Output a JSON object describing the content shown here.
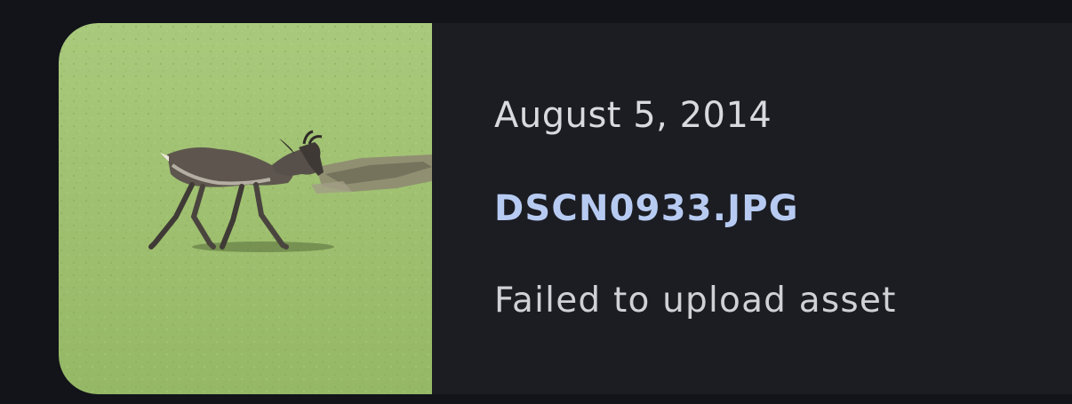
{
  "asset": {
    "date": "August 5, 2014",
    "filename": "DSCN0933.JPG",
    "status": "Failed to upload asset",
    "thumbnail_icon": "photo-thumbnail"
  },
  "colors": {
    "background": "#121419",
    "card": "#1b1d22",
    "filename_accent": "#b7cbf2",
    "text": "#d9dadd"
  }
}
